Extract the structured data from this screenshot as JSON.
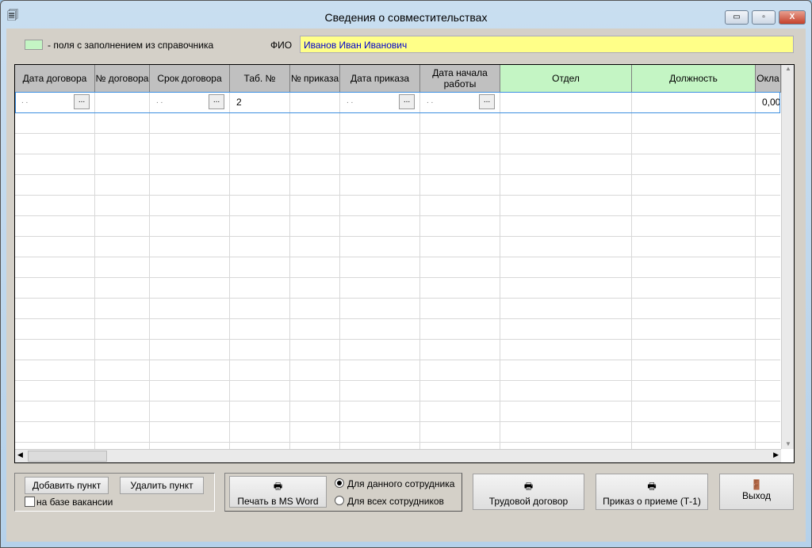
{
  "window": {
    "title": "Сведения о совместительствах",
    "minimize": "▭",
    "maximize": "▫",
    "close": "X"
  },
  "legend": {
    "text": "- поля с заполнением из справочника",
    "color": "#c4f5c4"
  },
  "fio": {
    "label": "ФИО",
    "value": "Иванов Иван Иванович"
  },
  "table": {
    "columns": [
      {
        "label": "Дата договора",
        "lookup": false
      },
      {
        "label": "№ договора",
        "lookup": false
      },
      {
        "label": "Срок договора",
        "lookup": false
      },
      {
        "label": "Таб. №",
        "lookup": false
      },
      {
        "label": "№ приказа",
        "lookup": false
      },
      {
        "label": "Дата приказа",
        "lookup": false
      },
      {
        "label": "Дата начала работы",
        "lookup": false
      },
      {
        "label": "Отдел",
        "lookup": true
      },
      {
        "label": "Должность",
        "lookup": true
      },
      {
        "label": "Окла",
        "lookup": false
      }
    ],
    "rows": [
      {
        "date_contract": ". .",
        "contract_no": "",
        "term": ". .",
        "tab_no": "2",
        "order_no": "",
        "order_date": ". .",
        "start_date": ". .",
        "department": "",
        "position": "",
        "salary": "0,00"
      }
    ],
    "ellipsis": "..."
  },
  "buttons": {
    "add": "Добавить пункт",
    "delete": "Удалить пункт",
    "vacancy": "на базе вакансии",
    "print_word": "Печать в MS Word",
    "radio_this": "Для данного сотрудника",
    "radio_all": "Для всех сотрудников",
    "contract": "Трудовой договор",
    "order": "Приказ о приеме (Т-1)",
    "exit": "Выход"
  },
  "state": {
    "radio_selected": "this",
    "vacancy_checked": false
  }
}
